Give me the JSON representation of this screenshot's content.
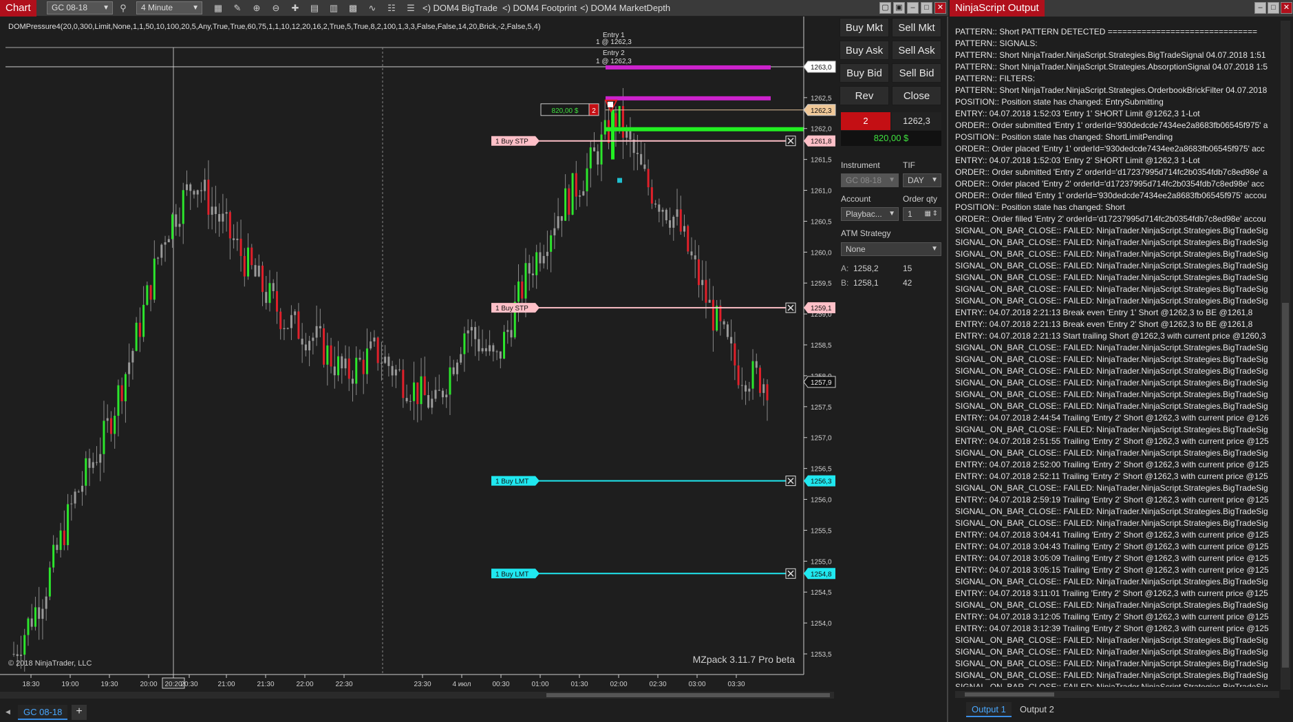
{
  "chart_window": {
    "title": "Chart",
    "instrument": "GC 08-18",
    "interval": "4 Minute",
    "dom_tools": [
      "<) DOM4 BigTrade",
      "<) DOM4 Footprint",
      "<) DOM4 MarketDepth"
    ],
    "indicator_label": "DOMPressure4(20,0,300,Limit,None,1,1,50,10,100,20,5,Any,True,True,60,75,1,1,10,12,20,16,2,True,5,True,8,2,100,1,3,3,False,False,14,20,Brick,-2,False,5,4)",
    "copyright": "© 2018 NinjaTrader, LLC",
    "watermark": "MZpack 3.11.7 Pro beta",
    "tab_label": "GC 08-18",
    "add_tab": "+"
  },
  "chart_data": {
    "type": "candlestick",
    "price_axis": {
      "ticks": [
        "1263,0",
        "1262,5",
        "1262,0",
        "1261,5",
        "1261,0",
        "1260,5",
        "1260,0",
        "1259,5",
        "1259,0",
        "1258,5",
        "1258,0",
        "1257,5",
        "1257,0",
        "1256,5",
        "1256,0",
        "1255,5",
        "1255,0",
        "1254,5",
        "1254,0",
        "1253,5"
      ],
      "range": [
        1253.3,
        1263.3
      ]
    },
    "time_axis": {
      "ticks": [
        "18:30",
        "19:00",
        "19:30",
        "20:00",
        "20:20",
        "20:30",
        "21:00",
        "21:30",
        "22:00",
        "22:30",
        "23:30",
        "4 июл",
        "00:30",
        "01:00",
        "01:30",
        "02:00",
        "02:30",
        "03:00",
        "03:30"
      ],
      "highlighted": "20:20"
    },
    "orders": [
      {
        "label": "1  Buy STP",
        "price": "1261,8",
        "color": "#ffc0c8"
      },
      {
        "label": "1  Buy STP",
        "price": "1259,1",
        "color": "#ffc0c8"
      },
      {
        "label": "1  Buy LMT",
        "price": "1256,3",
        "color": "#20e8f0"
      },
      {
        "label": "1  Buy LMT",
        "price": "1254,8",
        "color": "#20e8f0"
      }
    ],
    "price_markers": [
      {
        "price": "1263,0",
        "style": "white"
      },
      {
        "price": "1262,3",
        "style": "tan"
      },
      {
        "price": "1257,9",
        "style": "dark"
      }
    ],
    "entries": [
      {
        "label": "Entry 1",
        "detail": "1 @ 1262,3"
      },
      {
        "label": "Entry 2",
        "detail": "1 @ 1262,3"
      }
    ],
    "position": {
      "pnl": "820,00 $",
      "qty": "2"
    },
    "sample_prices": [
      1253.5,
      1254.5,
      1256.0,
      1257.0,
      1258.5,
      1260.3,
      1261.2,
      1260.4,
      1259.6,
      1258.9,
      1258.6,
      1258.0,
      1258.4,
      1257.9,
      1257.5,
      1258.8,
      1258.2,
      1259.6,
      1260.6,
      1261.3,
      1262.2,
      1261.1,
      1260.5,
      1259.2,
      1258.1,
      1257.9
    ]
  },
  "trader": {
    "buttons": [
      "Buy Mkt",
      "Sell Mkt",
      "Buy Ask",
      "Sell Ask",
      "Buy Bid",
      "Sell Bid",
      "Rev",
      "Close"
    ],
    "position_qty": "2",
    "position_price": "1262,3",
    "position_pnl": "820,00 $",
    "instrument_label": "Instrument",
    "tif_label": "TIF",
    "instrument_value": "GC 08-18",
    "tif_value": "DAY",
    "account_label": "Account",
    "order_qty_label": "Order qty",
    "account_value": "Playbac...",
    "order_qty_value": "1",
    "atm_label": "ATM Strategy",
    "atm_value": "None",
    "ask_label": "A:",
    "ask_price": "1258,2",
    "ask_size": "15",
    "bid_label": "B:",
    "bid_price": "1258,1",
    "bid_size": "42"
  },
  "output": {
    "title": "NinjaScript Output",
    "tabs": [
      "Output 1",
      "Output 2"
    ],
    "lines": [
      "PATTERN::   Short PATTERN DETECTED ===============================",
      "PATTERN::   SIGNALS:",
      "PATTERN::   Short NinjaTrader.NinjaScript.Strategies.BigTradeSignal 04.07.2018 1:51",
      "PATTERN::   Short NinjaTrader.NinjaScript.Strategies.AbsorptionSignal 04.07.2018 1:5",
      "PATTERN::   FILTERS:",
      "PATTERN::   Short NinjaTrader.NinjaScript.Strategies.OrderbookBrickFilter 04.07.2018",
      "POSITION::  Position state has changed: EntrySubmitting",
      "ENTRY::  04.07.2018 1:52:03 'Entry 1' SHORT Limit @1262,3 1-Lot",
      "ORDER::  Order submitted 'Entry 1' orderId='930dedcde7434ee2a8683fb06545f975' a",
      "POSITION::  Position state has changed: ShortLimitPending",
      "ORDER::  Order placed 'Entry 1' orderId='930dedcde7434ee2a8683fb06545f975' acc",
      "ENTRY::  04.07.2018 1:52:03 'Entry 2' SHORT Limit @1262,3 1-Lot",
      "ORDER::  Order submitted 'Entry 2' orderId='d17237995d714fc2b0354fdb7c8ed98e' a",
      "ORDER::  Order placed 'Entry 2' orderId='d17237995d714fc2b0354fdb7c8ed98e' acc",
      "ORDER::  Order filled 'Entry 1' orderId='930dedcde7434ee2a8683fb06545f975' accou",
      "POSITION::  Position state has changed: Short",
      "ORDER::  Order filled 'Entry 2' orderId='d17237995d714fc2b0354fdb7c8ed98e' accou",
      "SIGNAL_ON_BAR_CLOSE::  FAILED: NinjaTrader.NinjaScript.Strategies.BigTradeSig",
      "SIGNAL_ON_BAR_CLOSE::  FAILED: NinjaTrader.NinjaScript.Strategies.BigTradeSig",
      "SIGNAL_ON_BAR_CLOSE::  FAILED: NinjaTrader.NinjaScript.Strategies.BigTradeSig",
      "SIGNAL_ON_BAR_CLOSE::  FAILED: NinjaTrader.NinjaScript.Strategies.BigTradeSig",
      "SIGNAL_ON_BAR_CLOSE::  FAILED: NinjaTrader.NinjaScript.Strategies.BigTradeSig",
      "SIGNAL_ON_BAR_CLOSE::  FAILED: NinjaTrader.NinjaScript.Strategies.BigTradeSig",
      "SIGNAL_ON_BAR_CLOSE::  FAILED: NinjaTrader.NinjaScript.Strategies.BigTradeSig",
      "ENTRY::  04.07.2018 2:21:13 Break even 'Entry 1' Short @1262,3 to BE @1261,8",
      "ENTRY::  04.07.2018 2:21:13 Break even 'Entry 2' Short @1262,3 to BE @1261,8",
      "ENTRY::  04.07.2018 2:21:13 Start trailing Short @1262,3 with current price @1260,3",
      "SIGNAL_ON_BAR_CLOSE::  FAILED: NinjaTrader.NinjaScript.Strategies.BigTradeSig",
      "SIGNAL_ON_BAR_CLOSE::  FAILED: NinjaTrader.NinjaScript.Strategies.BigTradeSig",
      "SIGNAL_ON_BAR_CLOSE::  FAILED: NinjaTrader.NinjaScript.Strategies.BigTradeSig",
      "SIGNAL_ON_BAR_CLOSE::  FAILED: NinjaTrader.NinjaScript.Strategies.BigTradeSig",
      "SIGNAL_ON_BAR_CLOSE::  FAILED: NinjaTrader.NinjaScript.Strategies.BigTradeSig",
      "SIGNAL_ON_BAR_CLOSE::  FAILED: NinjaTrader.NinjaScript.Strategies.BigTradeSig",
      "ENTRY::  04.07.2018 2:44:54 Trailing 'Entry 2' Short @1262,3 with current price @126",
      "SIGNAL_ON_BAR_CLOSE::  FAILED: NinjaTrader.NinjaScript.Strategies.BigTradeSig",
      "ENTRY::  04.07.2018 2:51:55 Trailing 'Entry 2' Short @1262,3 with current price @125",
      "SIGNAL_ON_BAR_CLOSE::  FAILED: NinjaTrader.NinjaScript.Strategies.BigTradeSig",
      "ENTRY::  04.07.2018 2:52:00 Trailing 'Entry 2' Short @1262,3 with current price @125",
      "ENTRY::  04.07.2018 2:52:11 Trailing 'Entry 2' Short @1262,3 with current price @125",
      "SIGNAL_ON_BAR_CLOSE::  FAILED: NinjaTrader.NinjaScript.Strategies.BigTradeSig",
      "ENTRY::  04.07.2018 2:59:19 Trailing 'Entry 2' Short @1262,3 with current price @125",
      "SIGNAL_ON_BAR_CLOSE::  FAILED: NinjaTrader.NinjaScript.Strategies.BigTradeSig",
      "SIGNAL_ON_BAR_CLOSE::  FAILED: NinjaTrader.NinjaScript.Strategies.BigTradeSig",
      "ENTRY::  04.07.2018 3:04:41 Trailing 'Entry 2' Short @1262,3 with current price @125",
      "ENTRY::  04.07.2018 3:04:43 Trailing 'Entry 2' Short @1262,3 with current price @125",
      "ENTRY::  04.07.2018 3:05:09 Trailing 'Entry 2' Short @1262,3 with current price @125",
      "ENTRY::  04.07.2018 3:05:15 Trailing 'Entry 2' Short @1262,3 with current price @125",
      "SIGNAL_ON_BAR_CLOSE::  FAILED: NinjaTrader.NinjaScript.Strategies.BigTradeSig",
      "ENTRY::  04.07.2018 3:11:01 Trailing 'Entry 2' Short @1262,3 with current price @125",
      "SIGNAL_ON_BAR_CLOSE::  FAILED: NinjaTrader.NinjaScript.Strategies.BigTradeSig",
      "ENTRY::  04.07.2018 3:12:05 Trailing 'Entry 2' Short @1262,3 with current price @125",
      "ENTRY::  04.07.2018 3:12:39 Trailing 'Entry 2' Short @1262,3 with current price @125",
      "SIGNAL_ON_BAR_CLOSE::  FAILED: NinjaTrader.NinjaScript.Strategies.BigTradeSig",
      "SIGNAL_ON_BAR_CLOSE::  FAILED: NinjaTrader.NinjaScript.Strategies.BigTradeSig",
      "SIGNAL_ON_BAR_CLOSE::  FAILED: NinjaTrader.NinjaScript.Strategies.BigTradeSig",
      "SIGNAL_ON_BAR_CLOSE::  FAILED: NinjaTrader.NinjaScript.Strategies.BigTradeSig",
      "SIGNAL_ON_BAR_CLOSE::  FAILED: NinjaTrader.NinjaScript.Strategies.BigTradeSig"
    ]
  }
}
